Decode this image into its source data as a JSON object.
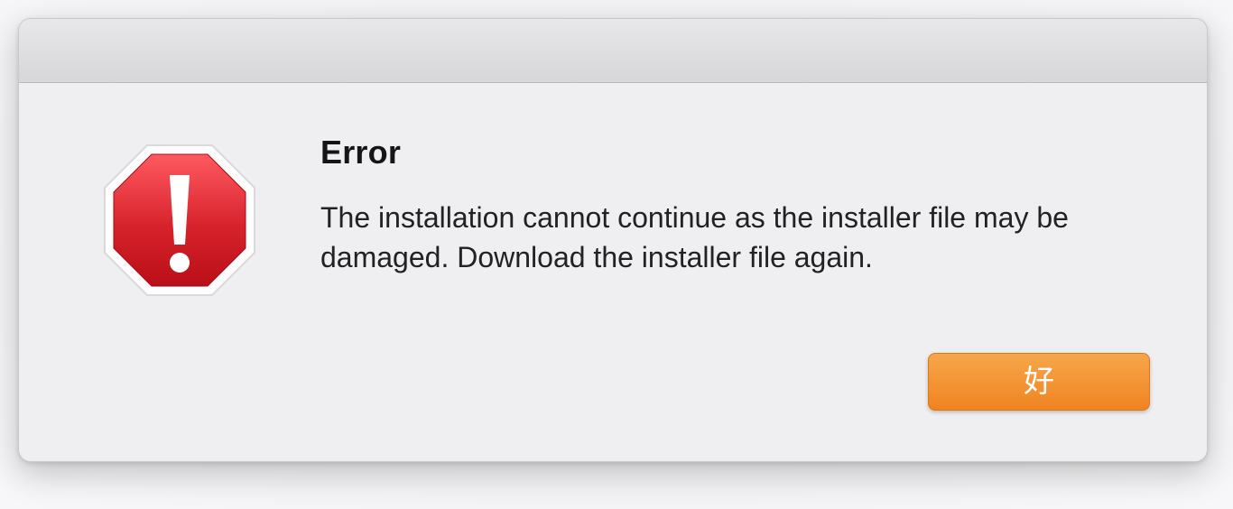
{
  "dialog": {
    "title": "Error",
    "message": "The installation cannot continue as the installer file may be damaged. Download the installer file again.",
    "ok_label": "好",
    "icon": "stop-alert-icon",
    "accent_color": "#f28b24",
    "alert_color": "#d81f2c"
  }
}
